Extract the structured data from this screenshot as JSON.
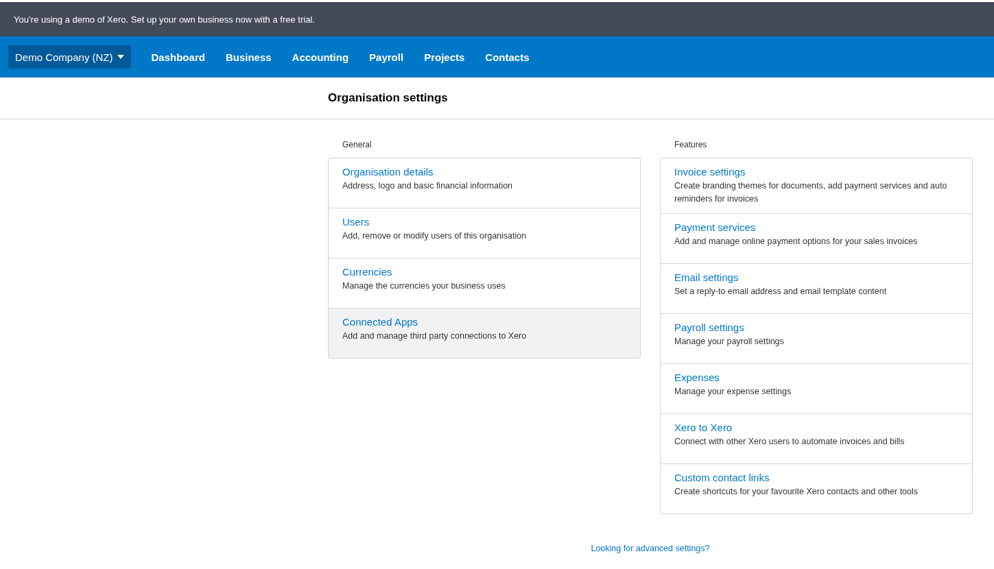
{
  "banner": {
    "text": "You’re using a demo of Xero. Set up your own business now with a free trial."
  },
  "nav": {
    "org_switcher": "Demo Company (NZ)",
    "items": [
      "Dashboard",
      "Business",
      "Accounting",
      "Payroll",
      "Projects",
      "Contacts"
    ]
  },
  "page_title": "Organisation settings",
  "sections": [
    {
      "heading": "General",
      "items": [
        {
          "title": "Organisation details",
          "description": "Address, logo and basic financial information",
          "highlighted": false
        },
        {
          "title": "Users",
          "description": "Add, remove or modify users of this organisation",
          "highlighted": false
        },
        {
          "title": "Currencies",
          "description": "Manage the currencies your business uses",
          "highlighted": false
        },
        {
          "title": "Connected Apps",
          "description": "Add and manage third party connections to Xero",
          "highlighted": true
        }
      ]
    },
    {
      "heading": "Features",
      "items": [
        {
          "title": "Invoice settings",
          "description": "Create branding themes for documents, add payment services and auto reminders for invoices",
          "highlighted": false
        },
        {
          "title": "Payment services",
          "description": "Add and manage online payment options for your sales invoices",
          "highlighted": false
        },
        {
          "title": "Email settings",
          "description": "Set a reply-to email address and email template content",
          "highlighted": false
        },
        {
          "title": "Payroll settings",
          "description": "Manage your payroll settings",
          "highlighted": false
        },
        {
          "title": "Expenses",
          "description": "Manage your expense settings",
          "highlighted": false
        },
        {
          "title": "Xero to Xero",
          "description": "Connect with other Xero users to automate invoices and bills",
          "highlighted": false
        },
        {
          "title": "Custom contact links",
          "description": "Create shortcuts for your favourite Xero contacts and other tools",
          "highlighted": false
        }
      ]
    }
  ],
  "footer_link": "Looking for advanced settings?"
}
